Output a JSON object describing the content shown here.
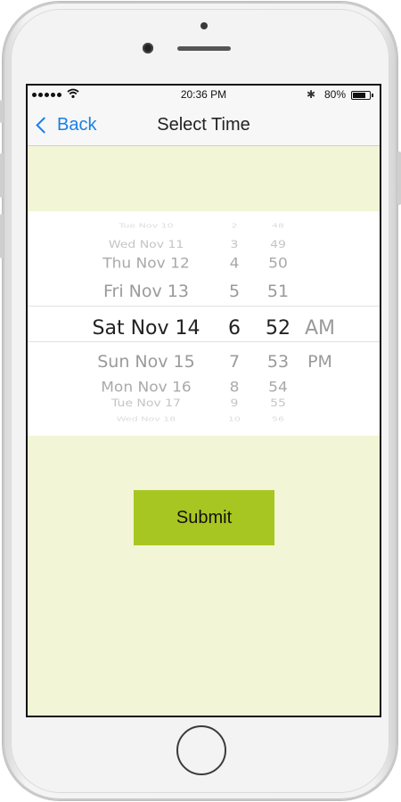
{
  "status_bar": {
    "time": "20:36 PM",
    "battery": "80%",
    "battery_level": 0.8,
    "signal_dots": 5
  },
  "nav": {
    "back_label": "Back",
    "title": "Select Time"
  },
  "picker": {
    "dates": [
      "Tue Nov 10",
      "Wed Nov 11",
      "Thu Nov 12",
      "Fri Nov 13",
      "Sat Nov 14",
      "Sun Nov 15",
      "Mon Nov 16",
      "Tue Nov 17",
      "Wed Nov 18"
    ],
    "hours": [
      "2",
      "3",
      "4",
      "5",
      "6",
      "7",
      "8",
      "9",
      "10"
    ],
    "minutes": [
      "48",
      "49",
      "50",
      "51",
      "52",
      "53",
      "54",
      "55",
      "56"
    ],
    "periods": [
      "AM",
      "PM"
    ],
    "selected": {
      "date": "Sat Nov 14",
      "hour": "6",
      "minute": "52",
      "period": "AM"
    }
  },
  "submit_label": "Submit",
  "colors": {
    "accent_blue": "#1a7fe6",
    "submit_green": "#a8c621",
    "background_tint": "#f2f5d6"
  }
}
